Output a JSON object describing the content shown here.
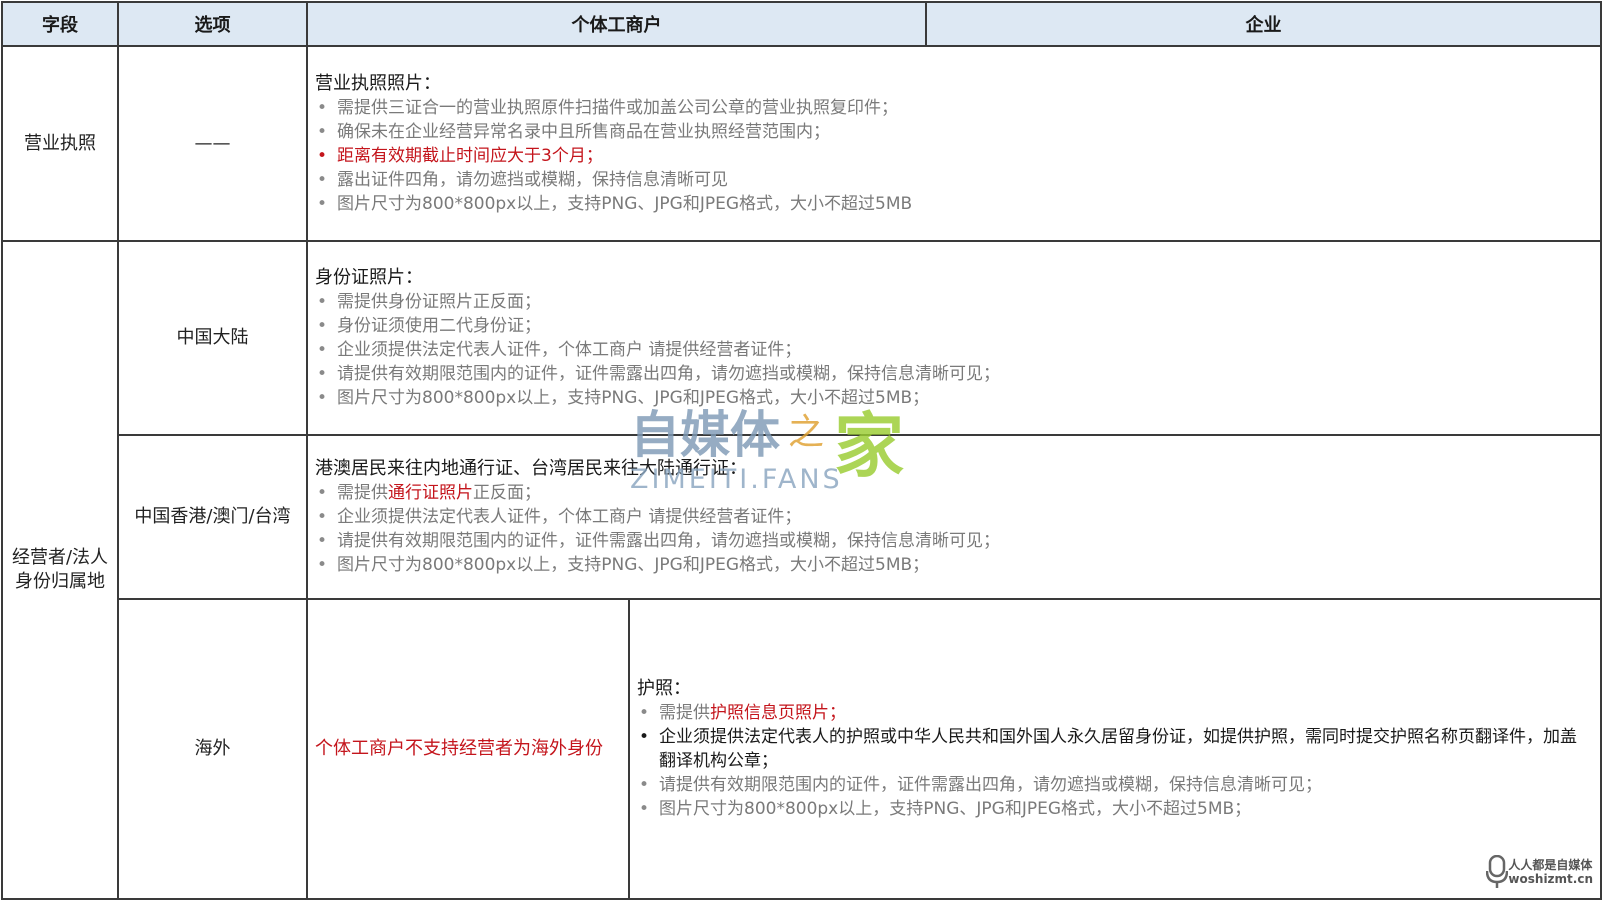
{
  "header": {
    "field": "字段",
    "option": "选项",
    "individual": "个体工商户",
    "enterprise": "企业"
  },
  "business_license": {
    "field": "营业执照",
    "option": "——",
    "title": "营业执照照片：",
    "items": [
      "需提供三证合一的营业执照原件扫描件或加盖公司公章的营业执照复印件；",
      "确保未在企业经营异常名录中且所售商品在营业执照经营范围内；",
      "距离有效期截止时间应大于3个月；",
      "露出证件四角，请勿遮挡或模糊，保持信息清晰可见",
      "图片尺寸为800*800px以上，支持PNG、JPG和JPEG格式，大小不超过5MB"
    ]
  },
  "identity": {
    "field": "经营者/法人身份归属地",
    "mainland": {
      "option": "中国大陆",
      "title": "身份证照片：",
      "items": [
        "需提供身份证照片正反面；",
        "身份证须使用二代身份证；",
        "企业须提供法定代表人证件，个体工商户 请提供经营者证件；",
        "请提供有效期限范围内的证件，证件需露出四角，请勿遮挡或模糊，保持信息清晰可见；",
        "图片尺寸为800*800px以上，支持PNG、JPG和JPEG格式，大小不超过5MB；"
      ]
    },
    "hmt": {
      "option": "中国香港/澳门/台湾",
      "title": "港澳居民来往内地通行证、台湾居民来往大陆通行证：",
      "item1_pre": "需提供",
      "item1_red": "通行证照片",
      "item1_post": "正反面；",
      "items": [
        "企业须提供法定代表人证件，个体工商户 请提供经营者证件；",
        "请提供有效期限范围内的证件，证件需露出四角，请勿遮挡或模糊，保持信息清晰可见；",
        "图片尺寸为800*800px以上，支持PNG、JPG和JPEG格式，大小不超过5MB；"
      ]
    },
    "overseas": {
      "option": "海外",
      "individual_notice": "个体工商户不支持经营者为海外身份",
      "title": "护照：",
      "item1_pre": "需提供",
      "item1_red": "护照信息页照片；",
      "item2": "企业须提供法定代表人的护照或中华人民共和国外国人永久居留身份证，如提供护照，需同时提交护照名称页翻译件，加盖翻译机构公章；",
      "item3": "请提供有效期限范围内的证件，证件需露出四角，请勿遮挡或模糊，保持信息清晰可见；",
      "item4": "图片尺寸为800*800px以上，支持PNG、JPG和JPEG格式，大小不超过5MB；"
    }
  },
  "watermark": {
    "brand": "自媒体之家",
    "domain": "ZIMEITI.FANS",
    "corner_line1": "人人都是自媒体",
    "corner_line2": "woshizmt.cn"
  },
  "colors": {
    "header_bg": "#dde8f3",
    "accent_red": "#c4151c",
    "muted_text": "#7a7a7a",
    "watermark_blue": "#7f9bb6",
    "watermark_green": "#9acd32"
  }
}
